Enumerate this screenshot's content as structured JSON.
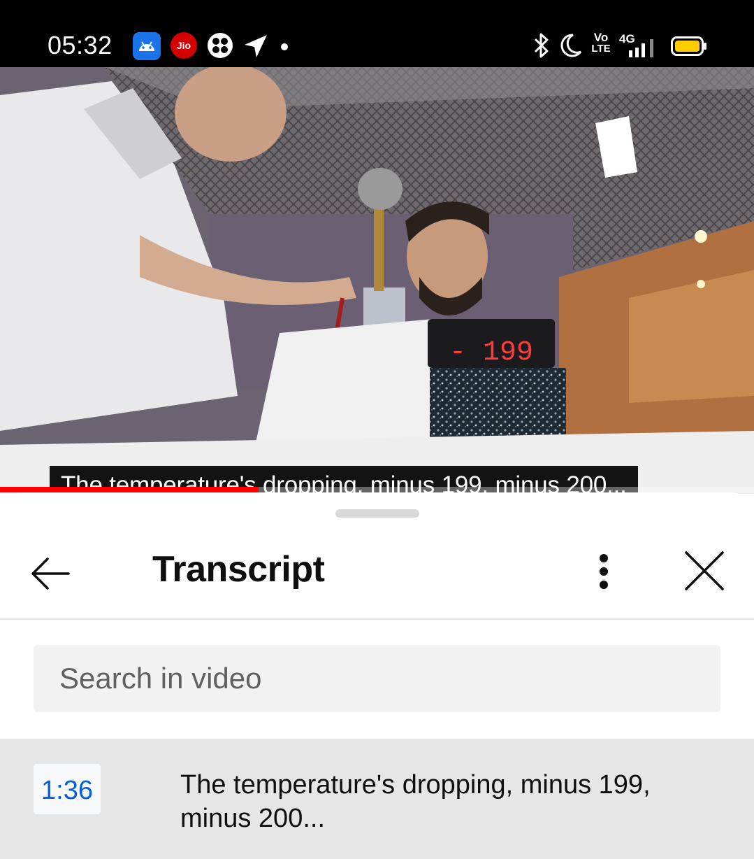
{
  "status_bar": {
    "time": "05:32",
    "network_label_vo": "Vo",
    "network_label_lte": "LTE",
    "network_type": "4G",
    "icons": [
      "android-icon",
      "jio-icon",
      "app-icon",
      "location-arrow-icon",
      "dot-icon",
      "bluetooth-icon",
      "moon-icon",
      "signal-icon",
      "battery-icon"
    ],
    "jio_label": "Jio"
  },
  "video": {
    "caption": "The temperature's dropping, minus 199, minus 200...",
    "display_reading": "- 199",
    "progress": 0.343,
    "progress_color": "#ff0000"
  },
  "sheet": {
    "title": "Transcript",
    "search_placeholder": "Search in video",
    "segments": [
      {
        "time": "1:36",
        "text": "The temperature's dropping, minus 199, minus 200..."
      }
    ]
  }
}
